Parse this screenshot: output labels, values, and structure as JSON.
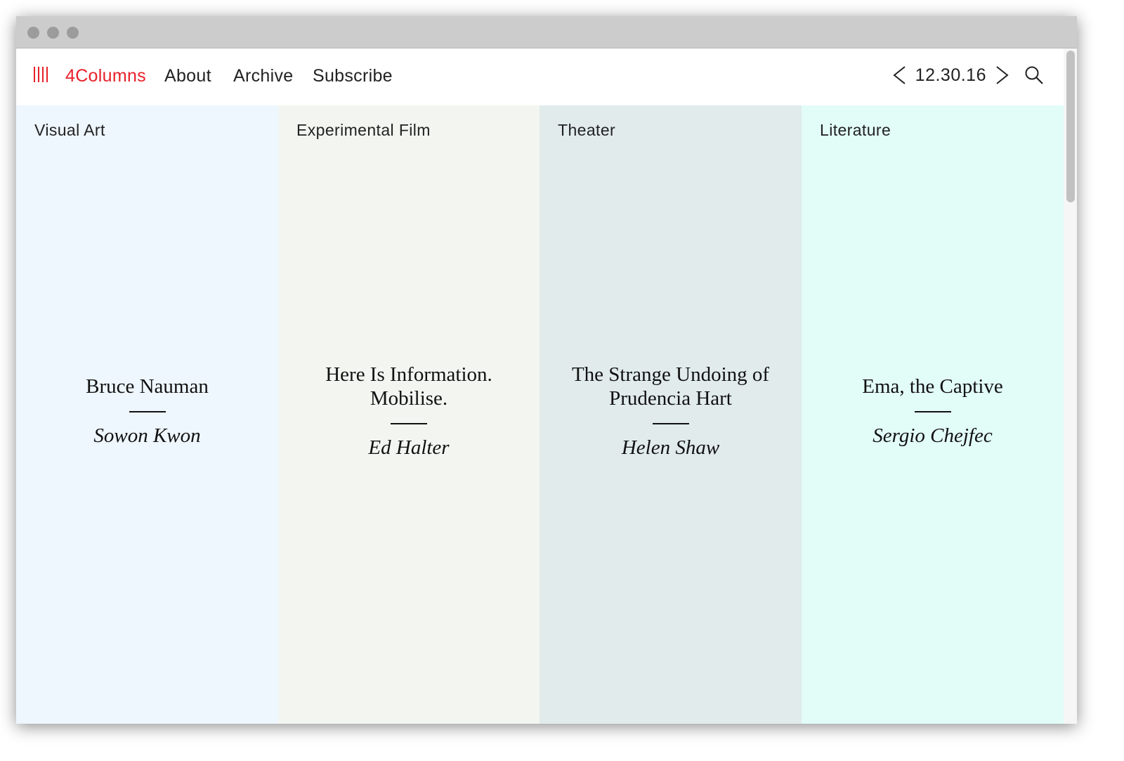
{
  "nav": {
    "brand": "4Columns",
    "links": [
      "About",
      "Archive",
      "Subscribe"
    ],
    "date": "12.30.16",
    "icons": {
      "brand": "four-bars-icon",
      "prev": "chevron-left-icon",
      "next": "chevron-right-icon",
      "search": "search-icon"
    },
    "accent_color": "#e8202a"
  },
  "columns": [
    {
      "category": "Visual Art",
      "title": "Bruce Nauman",
      "author": "Sowon Kwon",
      "background": "#eef6fe"
    },
    {
      "category": "Experimental Film",
      "title": "Here Is Information. Mobilise.",
      "author": "Ed Halter",
      "background": "#f3f6f0"
    },
    {
      "category": "Theater",
      "title": "The Strange Undoing of Prudencia Hart",
      "author": "Helen Shaw",
      "background": "#e1ebec"
    },
    {
      "category": "Literature",
      "title": "Ema, the Captive",
      "author": "Sergio Chejfec",
      "background": "#e2fcf8"
    }
  ]
}
